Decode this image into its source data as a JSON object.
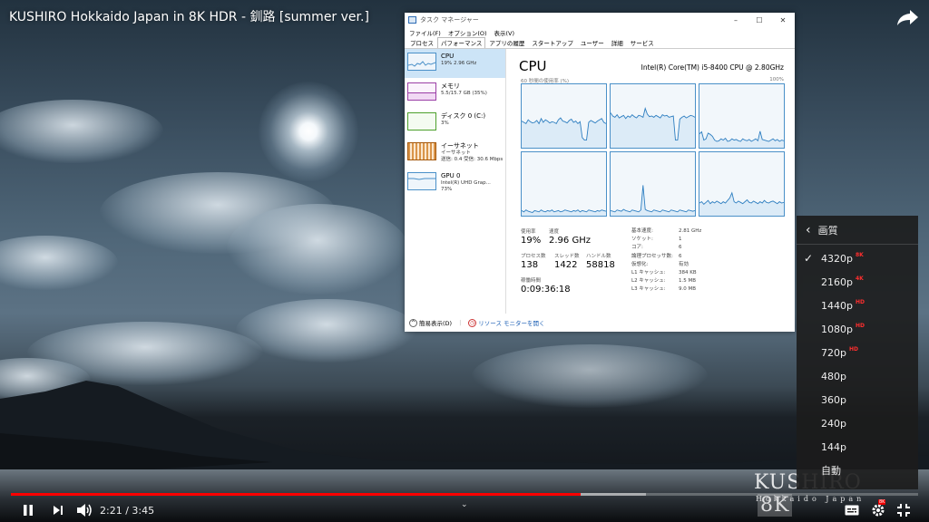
{
  "video": {
    "title": "KUSHIRO Hokkaido Japan in 8K HDR - 釧路 [summer ver.]",
    "time_current": "2:21",
    "time_total": "3:45",
    "time_separator": "/",
    "progress_fraction": 0.628,
    "buffer_fraction": 0.7,
    "watermark_main": "KUSHIRO",
    "watermark_badge": "8K",
    "watermark_sub": "Hokkaido Japan"
  },
  "task_manager": {
    "window_title": "タスク マネージャー",
    "menu": [
      "ファイル(F)",
      "オプション(O)",
      "表示(V)"
    ],
    "tabs": [
      "プロセス",
      "パフォーマンス",
      "アプリの履歴",
      "スタートアップ",
      "ユーザー",
      "詳細",
      "サービス"
    ],
    "active_tab": 1,
    "sidebar": [
      {
        "name": "CPU",
        "detail": "19%  2.96 GHz",
        "detail2": "",
        "color": "#4a90c8"
      },
      {
        "name": "メモリ",
        "detail": "5.5/15.7 GB (35%)",
        "detail2": "",
        "color": "#9b3fa6"
      },
      {
        "name": "ディスク 0 (C:)",
        "detail": "3%",
        "detail2": "",
        "color": "#4ca02c"
      },
      {
        "name": "イーサネット",
        "detail": "イーサネット",
        "detail2": "送信: 0.4  受信: 30.6 Mbps",
        "color": "#a4570b"
      },
      {
        "name": "GPU 0",
        "detail": "Intel(R) UHD Grap...",
        "detail2": "73%",
        "color": "#4a90c8"
      }
    ],
    "cpu_heading": "CPU",
    "cpu_model": "Intel(R) Core(TM) i5-8400 CPU @ 2.80GHz",
    "graph_label": "60 秒間の使用率 (%)",
    "graph_max": "100%",
    "stats": {
      "usage_label": "使用率",
      "usage_value": "19%",
      "speed_label": "速度",
      "speed_value": "2.96 GHz",
      "processes_label": "プロセス数",
      "processes_value": "138",
      "threads_label": "スレッド数",
      "threads_value": "1422",
      "handles_label": "ハンドル数",
      "handles_value": "58818",
      "uptime_label": "稼働時間",
      "uptime_value": "0:09:36:18"
    },
    "specs": [
      {
        "k": "基本速度:",
        "v": "2.81 GHz"
      },
      {
        "k": "ソケット:",
        "v": "1"
      },
      {
        "k": "コア:",
        "v": "6"
      },
      {
        "k": "論理プロセッサ数:",
        "v": "6"
      },
      {
        "k": "仮想化:",
        "v": "有効"
      },
      {
        "k": "L1 キャッシュ:",
        "v": "384 KB"
      },
      {
        "k": "L2 キャッシュ:",
        "v": "1.5 MB"
      },
      {
        "k": "L3 キャッシュ:",
        "v": "9.0 MB"
      }
    ],
    "footer_simple": "簡易表示(D)",
    "footer_link": "リソース モニターを開く",
    "core_series": [
      [
        42,
        40,
        38,
        44,
        41,
        39,
        40,
        43,
        38,
        46,
        40,
        44,
        42,
        39,
        41,
        40,
        38,
        44,
        47,
        42,
        41,
        39,
        43,
        45,
        40,
        42,
        38,
        41,
        16,
        12,
        12,
        40,
        43,
        41,
        39,
        42,
        44,
        46,
        40,
        38
      ],
      [
        55,
        50,
        48,
        52,
        47,
        49,
        51,
        46,
        50,
        48,
        52,
        49,
        47,
        51,
        50,
        48,
        62,
        53,
        49,
        50,
        48,
        51,
        49,
        47,
        52,
        50,
        51,
        48,
        49,
        50,
        12,
        12,
        45,
        48,
        50,
        47,
        49,
        51,
        50,
        48
      ],
      [
        22,
        25,
        12,
        14,
        23,
        21,
        18,
        12,
        10,
        11,
        14,
        12,
        15,
        10,
        11,
        14,
        12,
        13,
        11,
        10,
        14,
        12,
        11,
        13,
        10,
        12,
        14,
        11,
        26,
        13,
        12,
        11,
        10,
        12,
        14,
        11,
        13,
        10,
        12,
        11
      ],
      [
        8,
        6,
        9,
        7,
        6,
        5,
        8,
        7,
        6,
        9,
        7,
        6,
        8,
        7,
        9,
        6,
        7,
        8,
        6,
        7,
        9,
        8,
        7,
        6,
        8,
        7,
        9,
        6,
        8,
        7,
        6,
        9,
        8,
        7,
        6,
        8,
        7,
        9,
        8,
        7
      ],
      [
        8,
        7,
        6,
        9,
        8,
        7,
        10,
        8,
        7,
        6,
        9,
        8,
        7,
        6,
        9,
        48,
        10,
        8,
        7,
        6,
        9,
        8,
        7,
        6,
        9,
        8,
        7,
        6,
        9,
        8,
        7,
        6,
        9,
        8,
        7,
        6,
        9,
        8,
        7,
        8
      ],
      [
        20,
        22,
        18,
        21,
        24,
        19,
        22,
        20,
        23,
        21,
        19,
        22,
        20,
        24,
        28,
        36,
        22,
        20,
        23,
        21,
        19,
        22,
        25,
        21,
        20,
        23,
        21,
        19,
        22,
        20,
        24,
        21,
        20,
        22,
        23,
        21,
        19,
        22,
        20,
        21
      ],
      [
        12,
        14,
        11,
        13,
        12,
        10,
        14,
        13,
        11,
        12,
        14,
        13,
        11,
        24,
        12,
        13,
        11,
        14,
        12,
        13,
        11,
        12,
        14,
        13,
        11,
        12,
        14,
        13,
        11,
        12,
        14,
        13,
        11,
        12,
        14,
        13,
        11,
        12,
        13,
        12
      ]
    ]
  },
  "quality_menu": {
    "header": "画質",
    "items": [
      {
        "label": "4320p",
        "badge": "8K",
        "selected": true
      },
      {
        "label": "2160p",
        "badge": "4K",
        "selected": false
      },
      {
        "label": "1440p",
        "badge": "HD",
        "selected": false
      },
      {
        "label": "1080p",
        "badge": "HD",
        "selected": false
      },
      {
        "label": "720p",
        "badge": "HD",
        "selected": false
      },
      {
        "label": "480p",
        "badge": "",
        "selected": false
      },
      {
        "label": "360p",
        "badge": "",
        "selected": false
      },
      {
        "label": "240p",
        "badge": "",
        "selected": false
      },
      {
        "label": "144p",
        "badge": "",
        "selected": false
      },
      {
        "label": "自動",
        "badge": "",
        "selected": false
      }
    ],
    "settings_badge": "8K"
  }
}
